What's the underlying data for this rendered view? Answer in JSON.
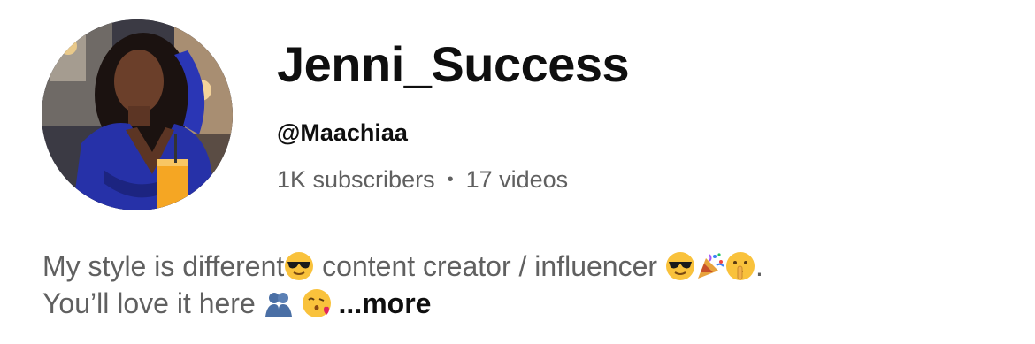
{
  "channel": {
    "name": "Jenni_Success",
    "handle": "@Maachiaa",
    "subscribers": "1K subscribers",
    "separator": "•",
    "videos": "17 videos",
    "avatar_icon": "profile-photo"
  },
  "description": {
    "part1": "My style is different",
    "part2": " content creator / influencer ",
    "part3": ".",
    "line2": "You’ll love it here ",
    "more_label": "...more",
    "emoji": [
      "sunglasses-face",
      "sunglasses-face",
      "party-popper",
      "shushing-face",
      "hugging-people",
      "face-blowing-kiss"
    ]
  },
  "colors": {
    "primary_text": "#0f0f0f",
    "secondary_text": "#606060"
  }
}
